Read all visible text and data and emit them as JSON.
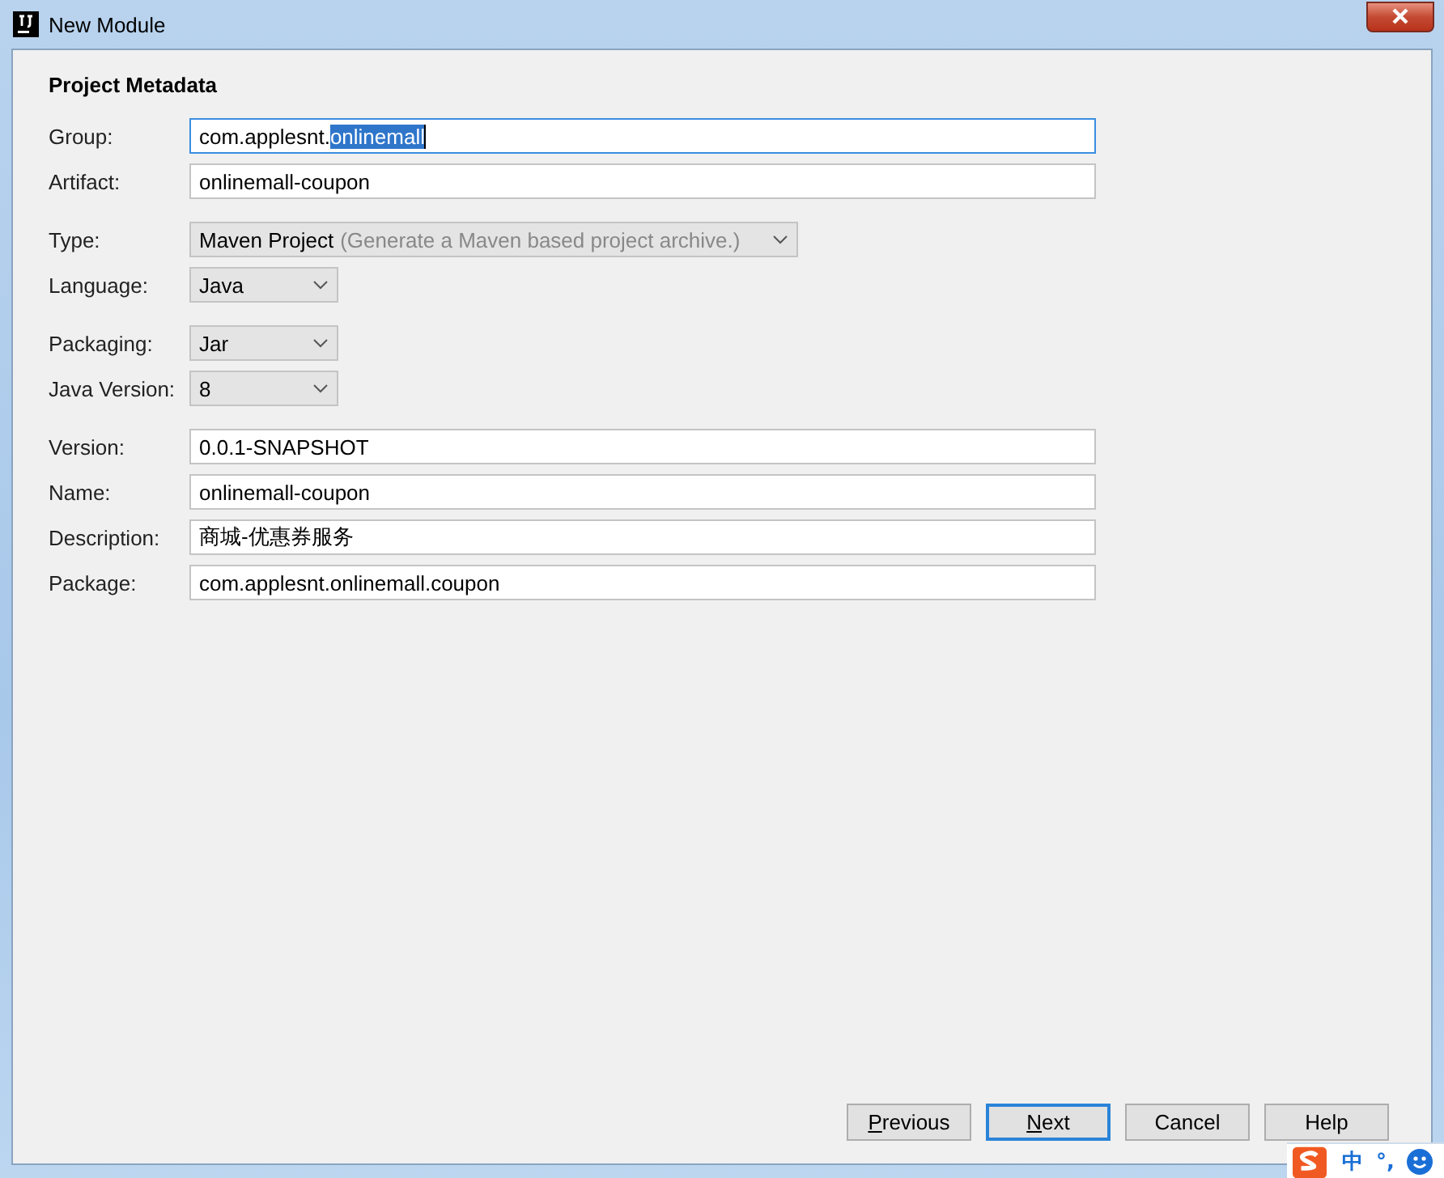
{
  "window": {
    "title": "New Module"
  },
  "section_title": "Project Metadata",
  "groups": [
    [
      {
        "label": "Group:",
        "kind": "text",
        "value": "com.applesnt.",
        "selected_text": "onlinemall",
        "focused": true
      },
      {
        "label": "Artifact:",
        "kind": "text",
        "value": "onlinemall-coupon",
        "focused": false
      }
    ],
    [
      {
        "label": "Type:",
        "kind": "combo",
        "value": "Maven Project",
        "hint": "(Generate a Maven based project archive.)"
      },
      {
        "label": "Language:",
        "kind": "combo",
        "value": "Java"
      }
    ],
    [
      {
        "label": "Packaging:",
        "kind": "combo",
        "value": "Jar"
      },
      {
        "label": "Java Version:",
        "kind": "combo",
        "value": "8"
      }
    ],
    [
      {
        "label": "Version:",
        "kind": "text",
        "value": "0.0.1-SNAPSHOT",
        "focused": false
      },
      {
        "label": "Name:",
        "kind": "text",
        "value": "onlinemall-coupon",
        "focused": false
      },
      {
        "label": "Description:",
        "kind": "text",
        "value": "商城-优惠券服务",
        "focused": false
      },
      {
        "label": "Package:",
        "kind": "text",
        "value": "com.applesnt.onlinemall.coupon",
        "focused": false
      }
    ]
  ],
  "buttons": [
    {
      "mnemonic": "P",
      "rest": "revious",
      "default": false
    },
    {
      "mnemonic": "N",
      "rest": "ext",
      "default": true
    },
    {
      "rest": "Cancel",
      "default": false
    },
    {
      "rest": "Help",
      "default": false
    }
  ],
  "ime_bar": {
    "mode": "中",
    "punctuation": "°,"
  }
}
